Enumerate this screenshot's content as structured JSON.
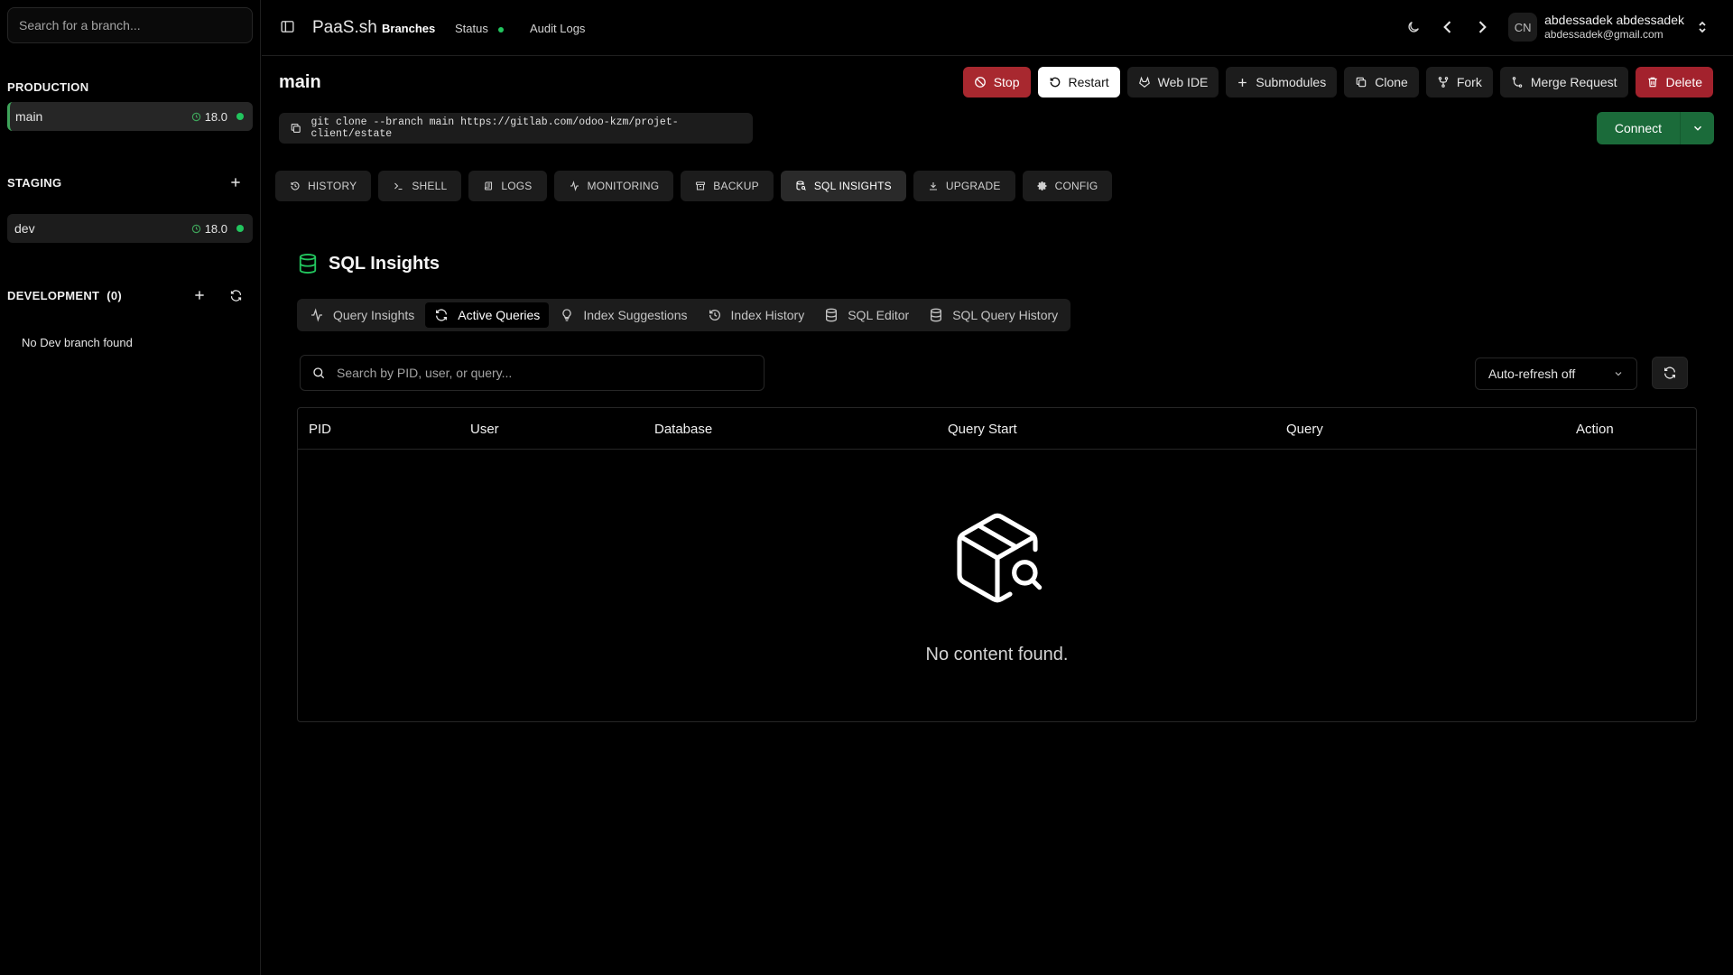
{
  "sidebar": {
    "search_placeholder": "Search for a branch...",
    "production": {
      "title": "PRODUCTION",
      "branches": [
        {
          "name": "main",
          "version": "18.0"
        }
      ]
    },
    "staging": {
      "title": "STAGING",
      "branches": [
        {
          "name": "dev",
          "version": "18.0"
        }
      ]
    },
    "development": {
      "title": "DEVELOPMENT",
      "count": "(0)",
      "empty_text": "No Dev branch found"
    }
  },
  "topbar": {
    "brand": "PaaS.sh",
    "nav": [
      "Branches",
      "Status",
      "Audit Logs"
    ],
    "user": {
      "initials": "CN",
      "name": "abdessadek abdessadek",
      "email": "abdessadek@gmail.com"
    }
  },
  "main": {
    "branch_title": "main",
    "actions": [
      "Stop",
      "Restart",
      "Web IDE",
      "Submodules",
      "Clone",
      "Fork",
      "Merge Request",
      "Delete"
    ],
    "clone_command": "git clone --branch main https://gitlab.com/odoo-kzm/projet-client/estate",
    "connect_label": "Connect",
    "tabs": [
      "HISTORY",
      "SHELL",
      "LOGS",
      "MONITORING",
      "BACKUP",
      "SQL INSIGHTS",
      "UPGRADE",
      "CONFIG"
    ],
    "active_tab": "SQL INSIGHTS"
  },
  "sql": {
    "title": "SQL Insights",
    "subtabs": [
      "Query Insights",
      "Active Queries",
      "Index Suggestions",
      "Index History",
      "SQL Editor",
      "SQL Query History"
    ],
    "active_subtab": "Active Queries",
    "search_placeholder": "Search by PID, user, or query...",
    "auto_refresh": "Auto-refresh off",
    "columns": [
      "PID",
      "User",
      "Database",
      "Query Start",
      "Query",
      "Action"
    ],
    "empty_text": "No content found."
  },
  "colors": {
    "accent_green": "#22c55e",
    "danger": "#a3222d",
    "connect": "#1b6b3a"
  }
}
